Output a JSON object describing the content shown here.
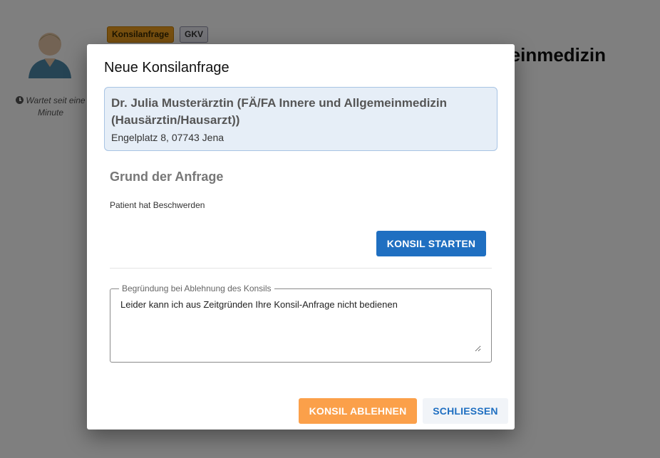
{
  "background": {
    "wait_text": "Wartet seit eine Minute",
    "badge_konsil": "Konsilanfrage",
    "badge_gkv": "GKV",
    "heading_fragment": "einmedizin"
  },
  "modal": {
    "title": "Neue Konsilanfrage",
    "doctor": {
      "name": "Dr. Julia Musterärztin (FÄ/FA Innere und Allgemeinmedizin (Hausärztin/Hausarzt))",
      "address": "Engelplatz 8, 07743 Jena"
    },
    "reason_title": "Grund der Anfrage",
    "reason_text": "Patient hat Beschwerden",
    "start_button": "KONSIL STARTEN",
    "reject_legend": "Begründung bei Ablehnung des Konsils",
    "reject_value": "Leider kann ich aus Zeitgründen Ihre Konsil-Anfrage nicht bedienen",
    "reject_button": "KONSIL ABLEHNEN",
    "close_button": "SCHLIESSEN"
  },
  "colors": {
    "primary": "#1f6fc1",
    "reject": "#fba04a",
    "card_bg": "#e6eef7"
  }
}
